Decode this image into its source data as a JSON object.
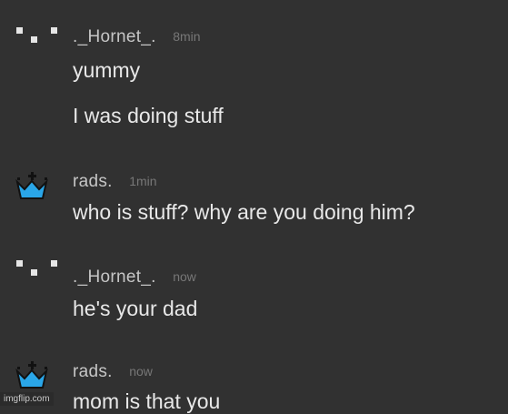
{
  "messages": [
    {
      "username": "._Hornet_.",
      "time": "8min",
      "avatar": "pixel-dots-icon",
      "lines": [
        "yummy",
        "I was doing stuff"
      ]
    },
    {
      "username": "rads.",
      "time": "1min",
      "avatar": "crown-icon",
      "lines": [
        "who is stuff? why are you doing him?"
      ]
    },
    {
      "username": "._Hornet_.",
      "time": "now",
      "avatar": "pixel-dots-icon",
      "lines": [
        "he's your dad"
      ]
    },
    {
      "username": "rads.",
      "time": "now",
      "avatar": "crown-icon",
      "lines": [
        "mom is that you"
      ]
    }
  ],
  "watermark": "imgflip.com",
  "colors": {
    "background": "#313131",
    "username": "#c6c6c6",
    "timestamp": "#777777",
    "message_text": "#e8e8e8",
    "crown": "#2aa6e8"
  }
}
